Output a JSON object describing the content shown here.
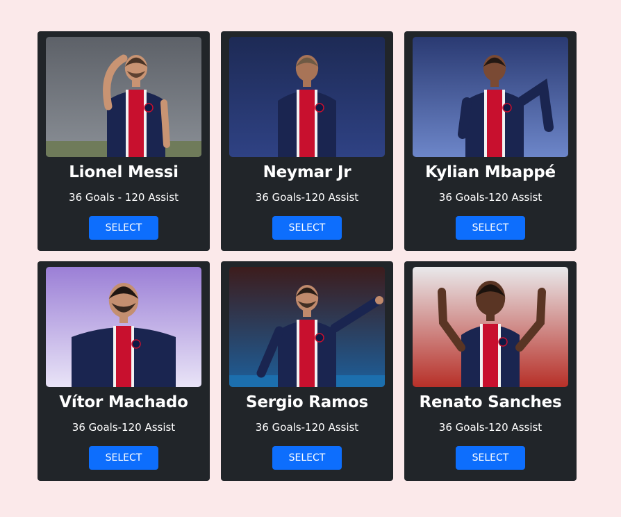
{
  "players": [
    {
      "name": "Lionel Messi",
      "stats": "36 Goals - 120 Assist",
      "button": "SELECT",
      "bg": "#5d6168",
      "bg2": "#8a8f96",
      "skin": "#c99473",
      "hair": "#4a3426",
      "beard": true,
      "pose": "hand-head",
      "accent": "#e4e6e8"
    },
    {
      "name": "Neymar Jr",
      "stats": "36 Goals-120 Assist",
      "button": "SELECT",
      "bg": "#1d2a55",
      "bg2": "#2f4284",
      "skin": "#a87457",
      "hair": "#6e5a44",
      "beard": false,
      "pose": "neutral",
      "accent": "#c8102e"
    },
    {
      "name": "Kylian Mbappé",
      "stats": "36 Goals-120 Assist",
      "button": "SELECT",
      "bg": "#2a3a72",
      "bg2": "#6d86c9",
      "skin": "#7a4a34",
      "hair": "#231813",
      "beard": false,
      "pose": "run",
      "accent": "#c8102e"
    },
    {
      "name": "Vítor Machado",
      "stats": "36 Goals-120 Assist",
      "button": "SELECT",
      "bg": "#9b7fd6",
      "bg2": "#e9e4f7",
      "skin": "#c48f70",
      "hair": "#1f1612",
      "beard": true,
      "pose": "neutral",
      "accent": "#c8102e"
    },
    {
      "name": "Sergio Ramos",
      "stats": "36 Goals-120 Assist",
      "button": "SELECT",
      "bg": "#3d1c1c",
      "bg2": "#1c5f9b",
      "skin": "#c08a6c",
      "hair": "#2a1e17",
      "beard": true,
      "pose": "point",
      "accent": "#c8102e"
    },
    {
      "name": "Renato Sanches",
      "stats": "36 Goals-120 Assist",
      "button": "SELECT",
      "bg": "#e9e9eb",
      "bg2": "#b73028",
      "skin": "#5a3524",
      "hair": "#1b120d",
      "beard": false,
      "pose": "fingers-up",
      "accent": "#c8102e"
    }
  ]
}
